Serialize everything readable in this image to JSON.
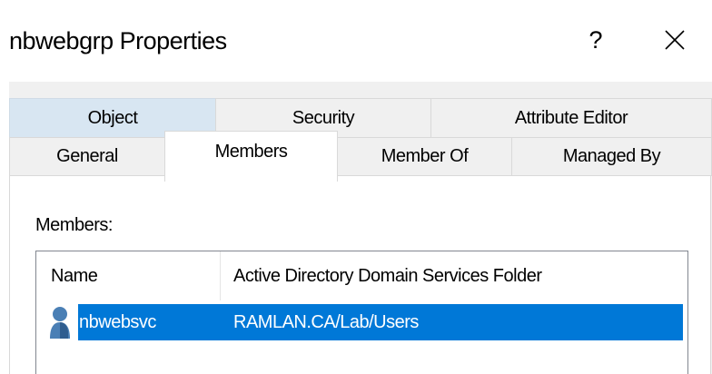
{
  "window": {
    "title": "nbwebgrp Properties",
    "help_glyph": "?",
    "close_glyph": "close-icon"
  },
  "tabs": {
    "row1": [
      "Object",
      "Security",
      "Attribute Editor"
    ],
    "row2": [
      "General",
      "Members",
      "Member Of",
      "Managed By"
    ],
    "active": "Members",
    "hovered": "Object"
  },
  "members_panel": {
    "label": "Members:",
    "columns": [
      "Name",
      "Active Directory Domain Services Folder"
    ],
    "rows": [
      {
        "name": "nbwebsvc",
        "folder": "RAMLAN.CA/Lab/Users",
        "icon": "user-icon",
        "selected": true
      }
    ]
  },
  "colors": {
    "selection": "#0078d7",
    "tab_hover": "#d8e6f2",
    "panel_bg": "#f0f0f0",
    "user_icon": "#4a7fb5"
  }
}
